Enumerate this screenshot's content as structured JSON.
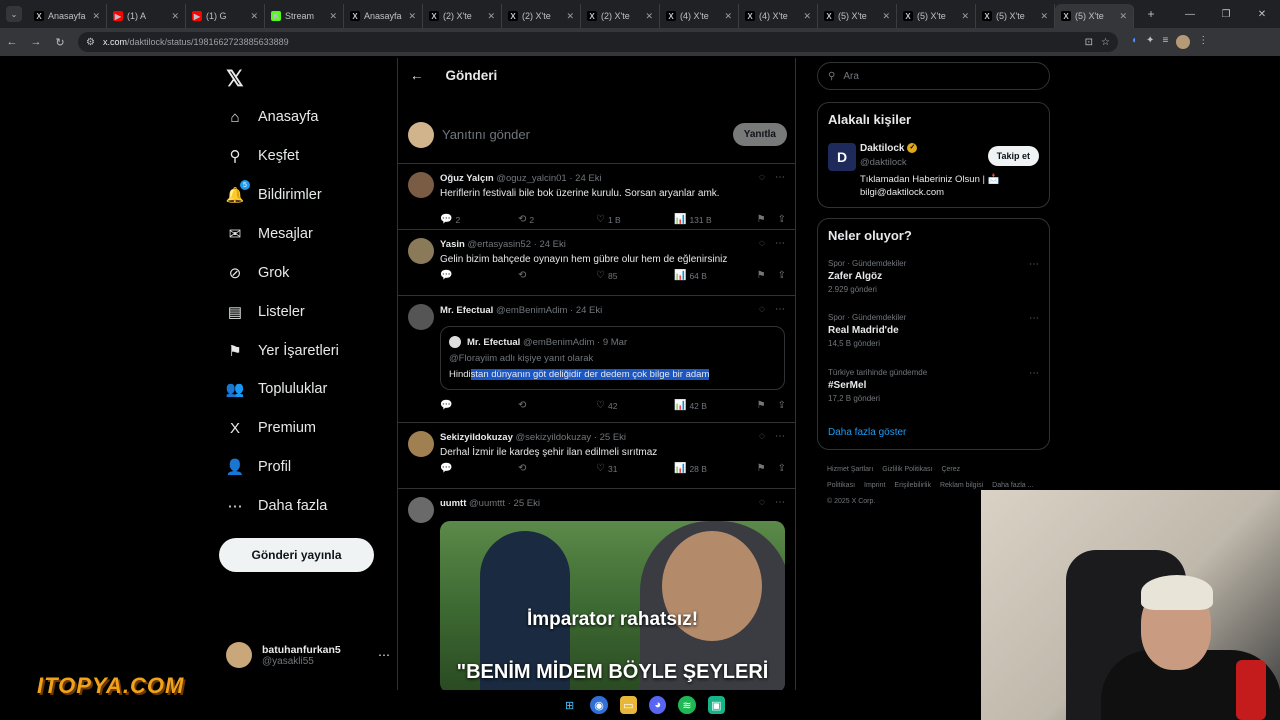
{
  "browser": {
    "tabs": [
      {
        "title": "Anasayfa",
        "fav": "X",
        "fav_bg": "#000000"
      },
      {
        "title": "(1) A",
        "fav": "▶",
        "fav_bg": "#ff0000"
      },
      {
        "title": "(1) G",
        "fav": "▶",
        "fav_bg": "#ff0000"
      },
      {
        "title": "Stream",
        "fav": "K",
        "fav_bg": "#53fc18"
      },
      {
        "title": "Anasayfa",
        "fav": "X",
        "fav_bg": "#000000"
      },
      {
        "title": "(2) X'te",
        "fav": "X",
        "fav_bg": "#000000"
      },
      {
        "title": "(2) X'te",
        "fav": "X",
        "fav_bg": "#000000"
      },
      {
        "title": "(2) X'te",
        "fav": "X",
        "fav_bg": "#000000"
      },
      {
        "title": "(4) X'te",
        "fav": "X",
        "fav_bg": "#000000"
      },
      {
        "title": "(4) X'te",
        "fav": "X",
        "fav_bg": "#000000"
      },
      {
        "title": "(5) X'te",
        "fav": "X",
        "fav_bg": "#000000"
      },
      {
        "title": "(5) X'te",
        "fav": "X",
        "fav_bg": "#000000"
      },
      {
        "title": "(5) X'te",
        "fav": "X",
        "fav_bg": "#000000"
      },
      {
        "title": "(5) X'te",
        "fav": "X",
        "fav_bg": "#000000"
      }
    ],
    "url_host": "x.com",
    "url_path": "/daktilock/status/1981662723885633889"
  },
  "nav": {
    "items": [
      {
        "label": "Anasayfa",
        "icon": "⌂"
      },
      {
        "label": "Keşfet",
        "icon": "⚲"
      },
      {
        "label": "Bildirimler",
        "icon": "🔔",
        "badge": "5"
      },
      {
        "label": "Mesajlar",
        "icon": "✉"
      },
      {
        "label": "Grok",
        "icon": "⊘"
      },
      {
        "label": "Listeler",
        "icon": "▤"
      },
      {
        "label": "Yer İşaretleri",
        "icon": "⚑"
      },
      {
        "label": "Topluluklar",
        "icon": "👥"
      },
      {
        "label": "Premium",
        "icon": "X"
      },
      {
        "label": "Profil",
        "icon": "👤"
      },
      {
        "label": "Daha fazla",
        "icon": "⋯"
      }
    ],
    "post_button": "Gönderi yayınla",
    "account_name": "batuhanfurkan5",
    "account_handle": "@yasakli55"
  },
  "main": {
    "title": "Gönderi",
    "reply_placeholder": "Yanıtını gönder",
    "reply_button": "Yanıtla",
    "tweets": [
      {
        "name": "Oğuz Yalçın",
        "handle": "@oguz_yalcin01",
        "date": "24 Eki",
        "text": "Heriflerin festivali bile bok üzerine kurulu. Sorsan aryanlar amk.",
        "replies": "2",
        "retweets": "2",
        "likes": "1 B",
        "views": "131 B",
        "avatar_color": "#7a5c44"
      },
      {
        "name": "Yasin",
        "handle": "@ertasyasin52",
        "date": "24 Eki",
        "text": "Gelin bizim bahçede oynayın hem gübre olur hem de eğlenirsiniz",
        "replies": "",
        "retweets": "",
        "likes": "85",
        "views": "64 B",
        "avatar_color": "#8a7a5a"
      },
      {
        "name": "Mr. Efectual",
        "handle": "@emBenimAdim",
        "date": "24 Eki",
        "text": "",
        "replies": "",
        "retweets": "",
        "likes": "42",
        "views": "42 B",
        "avatar_color": "#555555",
        "quote": {
          "name": "Mr. Efectual",
          "handle": "@emBenimAdim",
          "date": "9 Mar",
          "context": "@Florayiim adlı kişiye yanıt olarak",
          "text_plain": "Hindi",
          "text_selected": "stan dünyanın göt deliğidir der dedem çok bilge bir adam"
        }
      },
      {
        "name": "Sekizyildokuzay",
        "handle": "@sekizyildokuzay",
        "date": "25 Eki",
        "text": "Derhal İzmir ile kardeş şehir ilan edilmeli sırıtmaz",
        "replies": "",
        "retweets": "",
        "likes": "31",
        "views": "28 B",
        "avatar_color": "#a08050"
      },
      {
        "name": "uumtt",
        "handle": "@uumttt",
        "date": "25 Eki",
        "text": "",
        "avatar_color": "#6a6a6a",
        "media_caption_top": "İmparator rahatsız!",
        "media_caption_bottom": "\"BENİM MİDEM BÖYLE ŞEYLERİ"
      }
    ]
  },
  "right": {
    "search_placeholder": "Ara",
    "people_title": "Alakalı kişiler",
    "person_name": "Daktilock",
    "person_handle": "@daktilock",
    "person_bio": "Tıklamadan Haberiniz Olsun | 📩 bilgi@daktilock.com",
    "follow_label": "Takip et",
    "trends_title": "Neler oluyor?",
    "trends": [
      {
        "category": "Spor · Gündemdekiler",
        "name": "Zafer Algöz",
        "count": "2.929 gönderi"
      },
      {
        "category": "Spor · Gündemdekiler",
        "name": "Real Madrid'de",
        "count": "14,5 B gönderi"
      },
      {
        "category": "Türkiye tarihinde gündemde",
        "name": "#SerMel",
        "count": "17,2 B gönderi"
      }
    ],
    "show_more": "Daha fazla göster",
    "footer_links": [
      "Hizmet Şartları",
      "Gizlilik Politikası",
      "Çerez Politikası",
      "Imprint",
      "Erişilebilirlik",
      "Reklam bilgisi",
      "Daha fazla ..."
    ],
    "copyright": "© 2025 X Corp."
  },
  "overlay": {
    "logo_text": "ITOPYA.COM"
  }
}
